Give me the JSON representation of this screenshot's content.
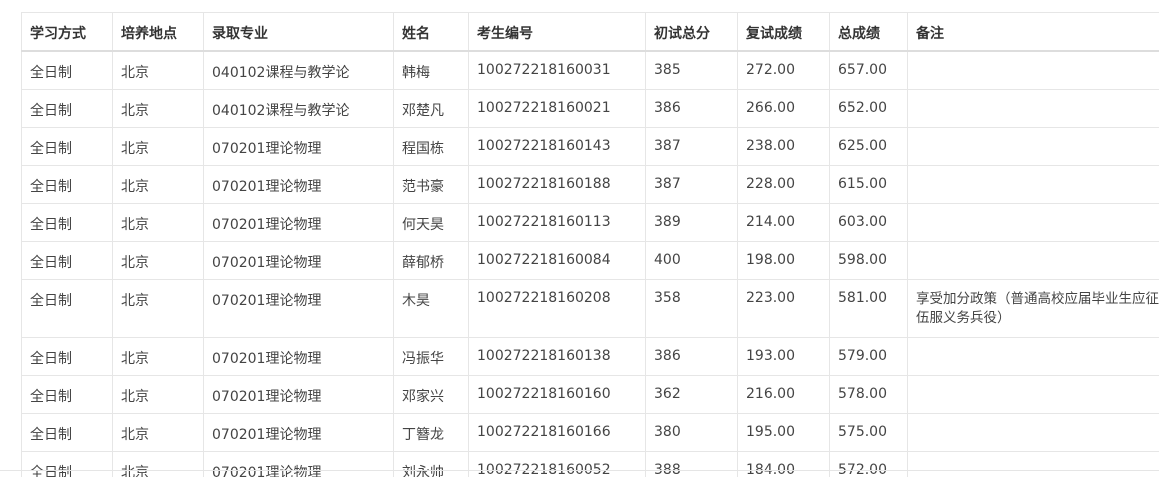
{
  "table": {
    "headers": [
      "学习方式",
      "培养地点",
      "录取专业",
      "姓名",
      "考生编号",
      "初试总分",
      "复试成绩",
      "总成绩",
      "备注"
    ],
    "rows": [
      [
        "全日制",
        "北京",
        "040102课程与教学论",
        "韩梅",
        "100272218160031",
        "385",
        "272.00",
        "657.00",
        ""
      ],
      [
        "全日制",
        "北京",
        "040102课程与教学论",
        "邓楚凡",
        "100272218160021",
        "386",
        "266.00",
        "652.00",
        ""
      ],
      [
        "全日制",
        "北京",
        "070201理论物理",
        "程国栋",
        "100272218160143",
        "387",
        "238.00",
        "625.00",
        ""
      ],
      [
        "全日制",
        "北京",
        "070201理论物理",
        "范书豪",
        "100272218160188",
        "387",
        "228.00",
        "615.00",
        ""
      ],
      [
        "全日制",
        "北京",
        "070201理论物理",
        "何天昊",
        "100272218160113",
        "389",
        "214.00",
        "603.00",
        ""
      ],
      [
        "全日制",
        "北京",
        "070201理论物理",
        "薛郁桥",
        "100272218160084",
        "400",
        "198.00",
        "598.00",
        ""
      ],
      [
        "全日制",
        "北京",
        "070201理论物理",
        "木昊",
        "100272218160208",
        "358",
        "223.00",
        "581.00",
        "享受加分政策（普通高校应届毕业生应征入伍服义务兵役）"
      ],
      [
        "全日制",
        "北京",
        "070201理论物理",
        "冯振华",
        "100272218160138",
        "386",
        "193.00",
        "579.00",
        ""
      ],
      [
        "全日制",
        "北京",
        "070201理论物理",
        "邓家兴",
        "100272218160160",
        "362",
        "216.00",
        "578.00",
        ""
      ],
      [
        "全日制",
        "北京",
        "070201理论物理",
        "丁簪龙",
        "100272218160166",
        "380",
        "195.00",
        "575.00",
        ""
      ],
      [
        "全日制",
        "北京",
        "070201理论物理",
        "刘永帅",
        "100272218160052",
        "388",
        "184.00",
        "572.00",
        ""
      ]
    ]
  }
}
